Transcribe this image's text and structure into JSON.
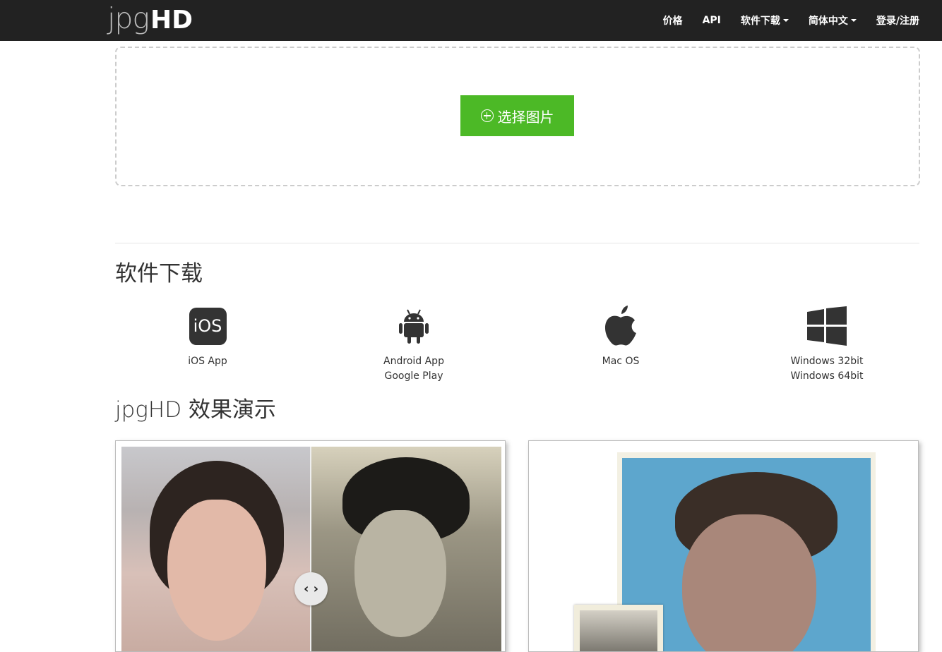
{
  "header": {
    "logo_thin": "jpg",
    "logo_bold": "HD",
    "nav": {
      "pricing": "价格",
      "api": "API",
      "download": "软件下载",
      "language": "简体中文",
      "login": "登录/注册"
    }
  },
  "upload": {
    "button_label": "选择图片"
  },
  "downloads": {
    "title": "软件下载",
    "ios": {
      "badge": "iOS",
      "lines": [
        "iOS App"
      ]
    },
    "android": {
      "lines": [
        "Android App",
        "Google Play"
      ]
    },
    "mac": {
      "lines": [
        "Mac OS"
      ]
    },
    "windows": {
      "lines": [
        "Windows 32bit",
        "Windows 64bit"
      ]
    }
  },
  "demo": {
    "title": "jpgHD 效果演示",
    "slider_icon": "left-right-arrows-icon"
  },
  "colors": {
    "topbar": "#222222",
    "accent_green": "#4cb926"
  }
}
